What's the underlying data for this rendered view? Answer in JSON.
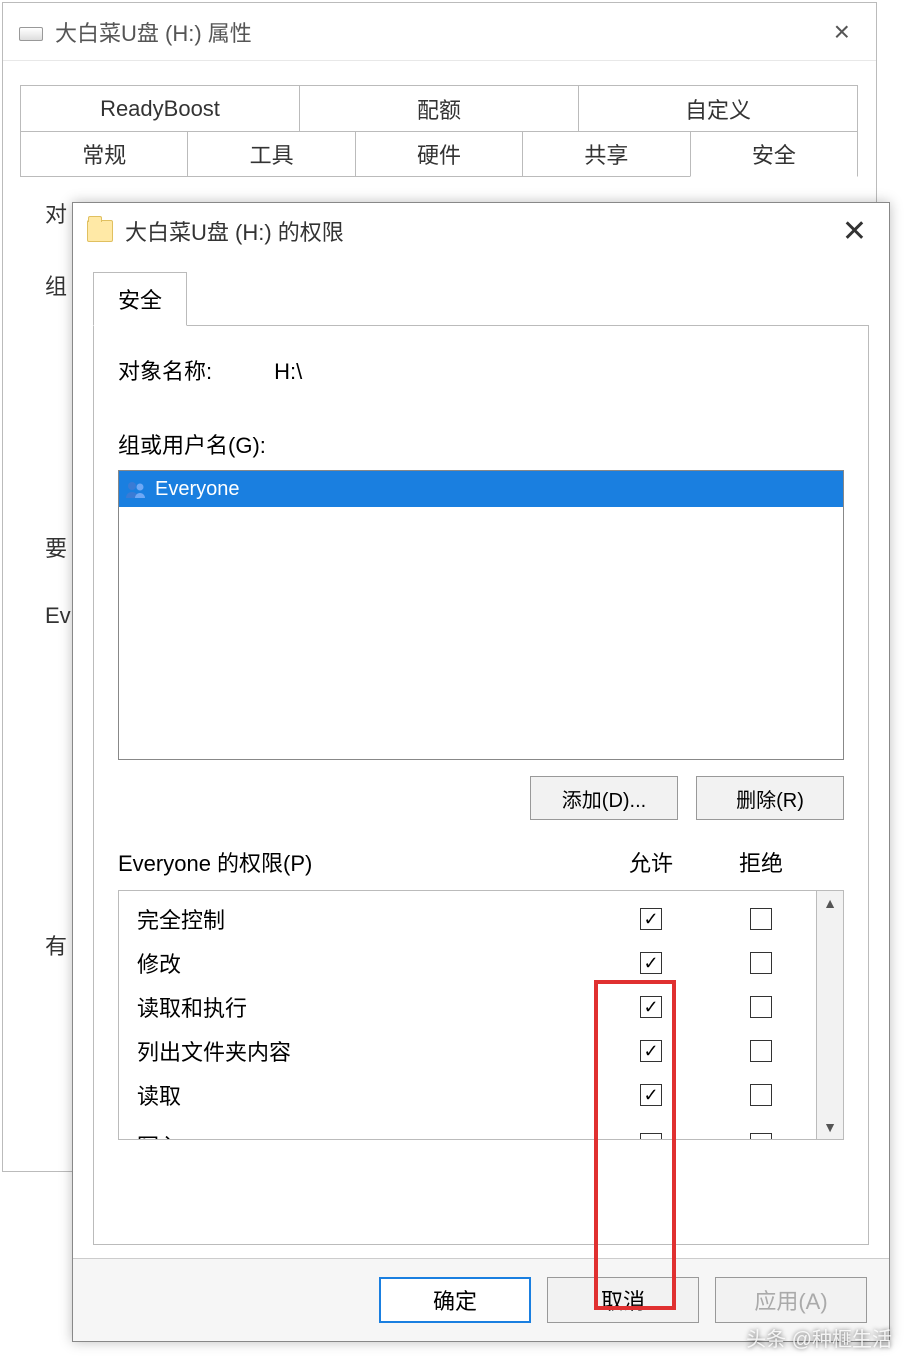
{
  "back": {
    "title": "大白菜U盘 (H:) 属性",
    "tabs_top": [
      "ReadyBoost",
      "配额",
      "自定义"
    ],
    "tabs_bottom": [
      "常规",
      "工具",
      "硬件",
      "共享",
      "安全"
    ],
    "active_tab": "安全",
    "body_lines": {
      "l1": "对",
      "l2": "组",
      "l3": "要",
      "l4": "Ev",
      "l5": "有"
    }
  },
  "front": {
    "title": "大白菜U盘 (H:) 的权限",
    "inner_tab": "安全",
    "object_label": "对象名称:",
    "object_value": "H:\\",
    "group_label": "组或用户名(G):",
    "user_list": [
      {
        "name": "Everyone",
        "selected": true
      }
    ],
    "buttons": {
      "add": "添加(D)...",
      "remove": "删除(R)"
    },
    "perm_label": "Everyone 的权限(P)",
    "col_allow": "允许",
    "col_deny": "拒绝",
    "permissions": [
      {
        "name": "完全控制",
        "allow": true,
        "deny": false
      },
      {
        "name": "修改",
        "allow": true,
        "deny": false
      },
      {
        "name": "读取和执行",
        "allow": true,
        "deny": false
      },
      {
        "name": "列出文件夹内容",
        "allow": true,
        "deny": false
      },
      {
        "name": "读取",
        "allow": true,
        "deny": false
      },
      {
        "name": "写入",
        "allow": true,
        "deny": false
      }
    ],
    "bottom": {
      "ok": "确定",
      "cancel": "取消",
      "apply": "应用(A)"
    }
  },
  "watermark": "头条 @种榧生活"
}
